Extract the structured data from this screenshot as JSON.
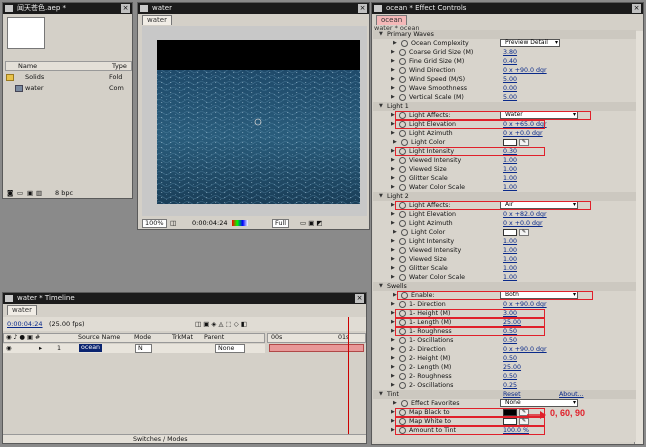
{
  "project": {
    "title": "闻天苍色.aep *",
    "columns": {
      "name": "Name",
      "type": "Type"
    },
    "items": [
      {
        "name": "Solids",
        "type": "Fold",
        "kind": "folder"
      },
      {
        "name": "water",
        "type": "Com",
        "kind": "comp"
      }
    ],
    "bpc": "8 bpc"
  },
  "comp": {
    "title": "water",
    "tab": "water",
    "zoom": "100%",
    "time": "0:00:04:24",
    "resolution": "Full"
  },
  "effect_controls": {
    "title": "ocean * Effect Controls",
    "tab": "ocean",
    "breadcrumb": "water * ocean",
    "rows": [
      {
        "label": "Primary Waves",
        "indent": 1,
        "section": true,
        "value": ""
      },
      {
        "label": "Ocean Complexity",
        "indent": 3,
        "dropdown": "Preview Detail",
        "value": ""
      },
      {
        "label": "Coarse Grid Size (M)",
        "indent": 2,
        "value": "3.80"
      },
      {
        "label": "Fine Grid Size (M)",
        "indent": 2,
        "value": "0.40"
      },
      {
        "label": "Wind Direction",
        "indent": 2,
        "value": "0 x +90.0 dgr"
      },
      {
        "label": "Wind Speed (M/S)",
        "indent": 2,
        "value": "5.00"
      },
      {
        "label": "Wave Smoothness",
        "indent": 2,
        "value": "0.00"
      },
      {
        "label": "Vertical Scale (M)",
        "indent": 2,
        "value": "5.00"
      },
      {
        "label": "Light 1",
        "indent": 1,
        "section": true,
        "value": ""
      },
      {
        "label": "Light Affects:",
        "indent": 2,
        "dropdown": "Water",
        "value": "",
        "highlight": true
      },
      {
        "label": "Light Elevation",
        "indent": 2,
        "value": "0 x +65.0 dgr",
        "highlight": true
      },
      {
        "label": "Light Azimuth",
        "indent": 2,
        "value": "0 x +0.0 dgr"
      },
      {
        "label": "Light Color",
        "indent": 3,
        "color": "#ffffff",
        "value": ""
      },
      {
        "label": "Light Intensity",
        "indent": 2,
        "value": "0.30",
        "highlight": true
      },
      {
        "label": "Viewed Intensity",
        "indent": 2,
        "value": "1.00"
      },
      {
        "label": "Viewed Size",
        "indent": 2,
        "value": "1.00"
      },
      {
        "label": "Glitter Scale",
        "indent": 2,
        "value": "1.00"
      },
      {
        "label": "Water Color Scale",
        "indent": 2,
        "value": "1.00"
      },
      {
        "label": "Light 2",
        "indent": 1,
        "section": true,
        "value": ""
      },
      {
        "label": "Light Affects:",
        "indent": 2,
        "dropdown": "Air",
        "value": "",
        "highlight": true
      },
      {
        "label": "Light Elevation",
        "indent": 2,
        "value": "0 x +82.0 dgr"
      },
      {
        "label": "Light Azimuth",
        "indent": 2,
        "value": "0 x +0.0 dgr"
      },
      {
        "label": "Light Color",
        "indent": 3,
        "color": "#ffffff",
        "value": ""
      },
      {
        "label": "Light Intensity",
        "indent": 2,
        "value": "1.00"
      },
      {
        "label": "Viewed Intensity",
        "indent": 2,
        "value": "1.00"
      },
      {
        "label": "Viewed Size",
        "indent": 2,
        "value": "1.00"
      },
      {
        "label": "Glitter Scale",
        "indent": 2,
        "value": "1.00"
      },
      {
        "label": "Water Color Scale",
        "indent": 2,
        "value": "1.00"
      },
      {
        "label": "Swells",
        "indent": 1,
        "section": true,
        "value": ""
      },
      {
        "label": "Enable:",
        "indent": 3,
        "dropdown": "Both",
        "value": "",
        "highlight": true
      },
      {
        "label": "1- Direction",
        "indent": 2,
        "value": "0 x +90.0 dgr"
      },
      {
        "label": "1- Height (M)",
        "indent": 2,
        "value": "3.00",
        "highlight": true
      },
      {
        "label": "1- Length (M)",
        "indent": 2,
        "value": "25.00",
        "highlight": true
      },
      {
        "label": "1- Roughness",
        "indent": 2,
        "value": "0.50",
        "highlight": true
      },
      {
        "label": "1- Oscillations",
        "indent": 2,
        "value": "0.50"
      },
      {
        "label": "2- Direction",
        "indent": 2,
        "value": "0 x +90.0 dgr"
      },
      {
        "label": "2- Height (M)",
        "indent": 2,
        "value": "0.50"
      },
      {
        "label": "2- Length (M)",
        "indent": 2,
        "value": "25.00"
      },
      {
        "label": "2- Roughness",
        "indent": 2,
        "value": "0.50"
      },
      {
        "label": "2- Oscillations",
        "indent": 2,
        "value": "0.25"
      },
      {
        "label": "Tint",
        "indent": 1,
        "section": true,
        "value": "",
        "reset": "Reset",
        "about": "About..."
      },
      {
        "label": "Effect Favorites",
        "indent": 3,
        "dropdown": "None",
        "value": ""
      },
      {
        "label": "Map Black to",
        "indent": 2,
        "color": "#000000",
        "value": "",
        "highlight": true
      },
      {
        "label": "Map White to",
        "indent": 2,
        "color": "#ffffff",
        "value": "",
        "highlight": true
      },
      {
        "label": "Amount to Tint",
        "indent": 2,
        "value": "100.0 %",
        "highlight": true
      }
    ],
    "annotation": "0, 60, 90",
    "annotation_color": "#e0202a"
  },
  "timeline": {
    "title": "water * Timeline",
    "tab": "water",
    "time": "0:00:04:24",
    "fps": "(25.00 fps)",
    "columns": {
      "source": "Source Name",
      "mode": "Mode",
      "trkmat": "TrkMat",
      "parent": "Parent"
    },
    "ruler": [
      "00s",
      "01s"
    ],
    "layer": {
      "num": "1",
      "name": "ocean",
      "mode": "N",
      "parent": "None"
    },
    "footer": "Switches / Modes"
  },
  "colors": {
    "highlight": "#e0202a",
    "value": "#0a2a8a",
    "titlebar": "#1b1b1b"
  }
}
